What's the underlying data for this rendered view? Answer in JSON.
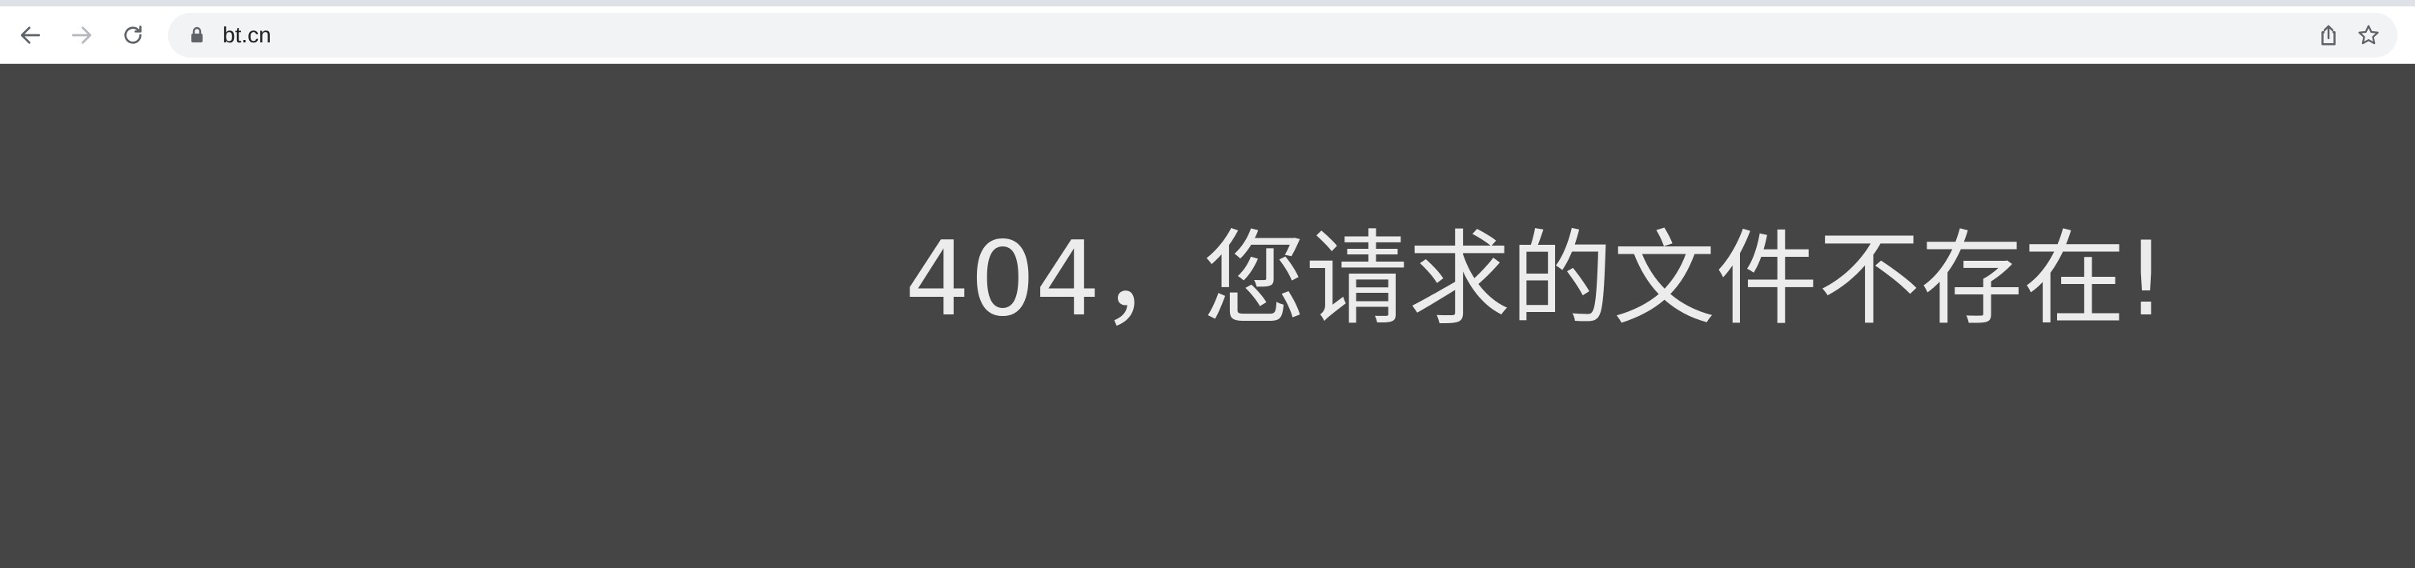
{
  "browser": {
    "url": "bt.cn",
    "icons": {
      "back": "back-arrow-icon",
      "forward": "forward-arrow-icon",
      "reload": "reload-icon",
      "lock": "lock-icon",
      "share": "share-icon",
      "bookmark": "star-icon"
    }
  },
  "page": {
    "message": "404，您请求的文件不存在!",
    "background_color": "#454545",
    "text_color": "#ececec"
  }
}
